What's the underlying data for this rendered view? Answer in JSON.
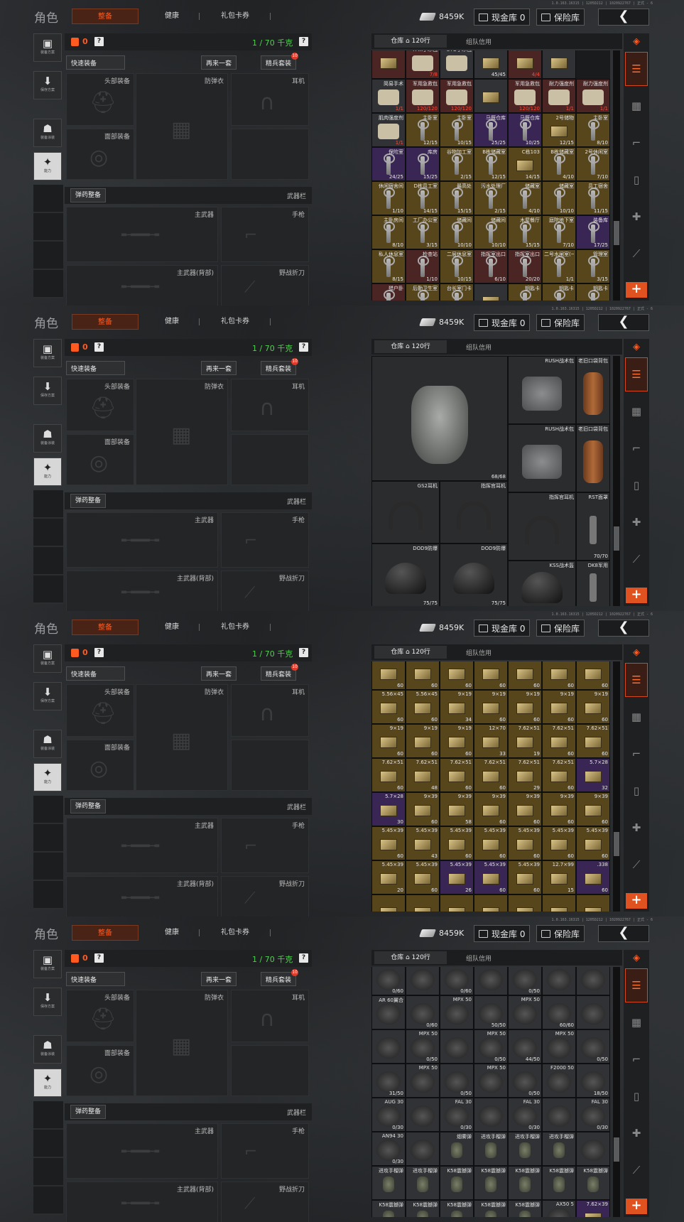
{
  "version": "1.0.163.16315 | 1205D212 | 1020922767 | 正式 - 6",
  "topbar": {
    "title": "角色",
    "tabs": [
      "整备",
      "健康",
      "礼包卡券"
    ],
    "coins": "8459K",
    "cash": "现金库 0",
    "safe": "保险库",
    "back": "❮"
  },
  "left": {
    "b1": "装备方案",
    "b2": "保存方案",
    "b3": "装备涂装",
    "b4": "能力"
  },
  "equip": {
    "count": "0",
    "help": "?",
    "weight": "1 / 70 千克",
    "quick": "快速装备",
    "again": "再来一套",
    "elite": "精兵套装",
    "elite_badge": "10",
    "head": "头部装备",
    "armor": "防弹衣",
    "ear": "耳机",
    "face": "面部装备",
    "ammo_btn": "弹药整备",
    "weapon_bar": "武器栏",
    "main": "主武器",
    "pistol": "手枪",
    "main_back": "主武器(背部)",
    "knife": "野战折刀"
  },
  "stash": {
    "tab1": "仓库 ⌂ 120行",
    "tab2": "组队信用",
    "plus": "+"
  },
  "accent": "#ff5a1f",
  "green": "#4fd14f",
  "gold_bg": "#57461c",
  "purple_bg": "#3a2654",
  "frames": [
    {
      "layout": "grid",
      "rows": [
        [
          {
            "n": "",
            "c": "",
            "t": "r"
          },
          {
            "n": "TMK手术包",
            "c": "7/8",
            "t": "r",
            "red": true,
            "span": 2
          },
          {
            "n": "STO手术包",
            "c": "",
            "t": "n"
          },
          {
            "n": "",
            "c": "45/45",
            "t": "n"
          },
          {
            "n": "",
            "c": "4/4",
            "t": "r",
            "red": true
          },
          {
            "n": "",
            "c": "",
            "t": "n"
          }
        ],
        [
          {
            "n": "简易手术",
            "c": "1/1",
            "t": "n",
            "red": true
          },
          {
            "n": "军用急救包",
            "c": "120/120",
            "t": "r",
            "red": true
          },
          {
            "n": "军用急救包",
            "c": "120/120",
            "t": "r",
            "red": true
          },
          {
            "n": "",
            "c": "",
            "t": "n"
          },
          {
            "n": "军用急救包",
            "c": "120/120",
            "t": "r",
            "red": true
          },
          {
            "n": "耐力强度剂",
            "c": "1/1",
            "t": "r",
            "red": true
          },
          {
            "n": "耐力强度剂",
            "c": "1/1",
            "t": "r",
            "red": true
          }
        ],
        [
          {
            "n": "肌肉强度剂",
            "c": "1/1",
            "t": "n",
            "red": true
          },
          {
            "n": "主卧室",
            "c": "12/15",
            "t": "g"
          },
          {
            "n": "主卧室",
            "c": "10/15",
            "t": "g"
          },
          {
            "n": "马厩仓库",
            "c": "25/25",
            "t": "p"
          },
          {
            "n": "马厩仓库",
            "c": "10/25",
            "t": "p"
          },
          {
            "n": "2号储物",
            "c": "12/15",
            "t": "g"
          },
          {
            "n": "主卧室",
            "c": "8/10",
            "t": "g"
          }
        ],
        [
          {
            "n": "保险室",
            "c": "24/25",
            "t": "p"
          },
          {
            "n": "库房",
            "c": "15/25",
            "t": "p"
          },
          {
            "n": "谷物加工室",
            "c": "2/15",
            "t": "g"
          },
          {
            "n": "B栋储藏室",
            "c": "12/15",
            "t": "g"
          },
          {
            "n": "C栋103",
            "c": "14/15",
            "t": "g"
          },
          {
            "n": "B栋储藏室",
            "c": "4/10",
            "t": "g"
          },
          {
            "n": "2号休闲室",
            "c": "7/10",
            "t": "g"
          }
        ],
        [
          {
            "n": "休闲宿舍间",
            "c": "1/10",
            "t": "g"
          },
          {
            "n": "D栋员工室",
            "c": "14/15",
            "t": "g"
          },
          {
            "n": "最高处",
            "c": "15/15",
            "t": "g"
          },
          {
            "n": "污水处理厂",
            "c": "2/15",
            "t": "g"
          },
          {
            "n": "储藏室",
            "c": "4/10",
            "t": "g"
          },
          {
            "n": "储藏室",
            "c": "10/10",
            "t": "g"
          },
          {
            "n": "员工宿舍",
            "c": "11/15",
            "t": "g"
          }
        ],
        [
          {
            "n": "主卧房间",
            "c": "8/10",
            "t": "g"
          },
          {
            "n": "工厂办公室",
            "c": "3/15",
            "t": "g"
          },
          {
            "n": "储藏间",
            "c": "10/10",
            "t": "g"
          },
          {
            "n": "储藏间",
            "c": "10/10",
            "t": "g"
          },
          {
            "n": "木屋餐厅",
            "c": "15/15",
            "t": "g"
          },
          {
            "n": "庭院地下室",
            "c": "7/10",
            "t": "g"
          },
          {
            "n": "装备库",
            "c": "17/25",
            "t": "p"
          }
        ],
        [
          {
            "n": "私人休息室",
            "c": "8/15",
            "t": "g"
          },
          {
            "n": "检查站",
            "c": "1/10",
            "t": "r"
          },
          {
            "n": "二层休息室",
            "c": "10/15",
            "t": "g"
          },
          {
            "n": "指挥室出口",
            "c": "6/10",
            "t": "r"
          },
          {
            "n": "指挥室出口",
            "c": "20/20",
            "t": "r"
          },
          {
            "n": "二号水闸室(一次性)",
            "c": "1/1",
            "t": "g"
          },
          {
            "n": "管理室",
            "c": "3/15",
            "t": "g"
          }
        ],
        [
          {
            "n": "猎户卧",
            "c": "",
            "t": "r"
          },
          {
            "n": "后勤卫生室",
            "c": "",
            "t": "g"
          },
          {
            "n": "台长室门卡",
            "c": "",
            "t": "g"
          },
          {
            "n": "",
            "c": "",
            "t": "n"
          },
          {
            "n": "钥匙卡",
            "c": "",
            "t": "g"
          },
          {
            "n": "钥匙卡",
            "c": "",
            "t": "g"
          },
          {
            "n": "钥匙卡",
            "c": "",
            "t": "g"
          }
        ]
      ]
    },
    {
      "layout": "big",
      "items": [
        {
          "n": "",
          "c": "68/68",
          "art": "vest"
        },
        {
          "n": "RUSH战术包",
          "c": "",
          "art": "pack"
        },
        {
          "n": "老旧口袋背包",
          "c": "",
          "art": "roll"
        },
        {
          "n": "RUSH战术包",
          "c": "",
          "art": "pack"
        },
        {
          "n": "老旧口袋背包",
          "c": "",
          "art": "roll"
        },
        {
          "n": "GS2耳机",
          "c": "",
          "art": "head"
        },
        {
          "n": "指挥官耳机",
          "c": "",
          "art": "head"
        },
        {
          "n": "指挥官耳机",
          "c": "",
          "art": "head"
        },
        {
          "n": "RST面罩",
          "c": "70/70",
          "art": "stick"
        },
        {
          "n": "DOD9防爆",
          "c": "75/75",
          "art": "helm"
        },
        {
          "n": "DOD9防爆",
          "c": "75/75",
          "art": "helm"
        },
        {
          "n": "KSS战术盔",
          "c": "",
          "art": "helm"
        },
        {
          "n": "DK8军用",
          "c": "",
          "art": "stick"
        }
      ]
    },
    {
      "layout": "grid",
      "rows": [
        [
          {
            "n": "5.56×45",
            "c": "60",
            "t": "g"
          },
          {
            "n": "5.56×45",
            "c": "60",
            "t": "g"
          },
          {
            "n": "5.56×45",
            "c": "60",
            "t": "g"
          },
          {
            "n": "5.56×45",
            "c": "60",
            "t": "g"
          },
          {
            "n": "5.56×45",
            "c": "60",
            "t": "g"
          },
          {
            "n": "5.56×45",
            "c": "60",
            "t": "g"
          },
          {
            "n": "5.56×45",
            "c": "60",
            "t": "g"
          }
        ],
        [
          {
            "n": "5.56×45",
            "c": "60",
            "t": "g"
          },
          {
            "n": "5.56×45",
            "c": "60",
            "t": "g"
          },
          {
            "n": "9×19",
            "c": "34",
            "t": "g"
          },
          {
            "n": "9×19",
            "c": "60",
            "t": "g"
          },
          {
            "n": "9×19",
            "c": "60",
            "t": "g"
          },
          {
            "n": "9×19",
            "c": "60",
            "t": "g"
          },
          {
            "n": "9×19",
            "c": "60",
            "t": "g"
          }
        ],
        [
          {
            "n": "9×19",
            "c": "60",
            "t": "g"
          },
          {
            "n": "9×19",
            "c": "60",
            "t": "g"
          },
          {
            "n": "9×19",
            "c": "60",
            "t": "g"
          },
          {
            "n": "12×70",
            "c": "33",
            "t": "g"
          },
          {
            "n": "7.62×51",
            "c": "19",
            "t": "g"
          },
          {
            "n": "7.62×51",
            "c": "60",
            "t": "g"
          },
          {
            "n": "7.62×51",
            "c": "60",
            "t": "g"
          }
        ],
        [
          {
            "n": "7.62×51",
            "c": "60",
            "t": "g"
          },
          {
            "n": "7.62×51",
            "c": "48",
            "t": "g"
          },
          {
            "n": "7.62×51",
            "c": "60",
            "t": "g"
          },
          {
            "n": "7.62×51",
            "c": "60",
            "t": "g"
          },
          {
            "n": "7.62×51",
            "c": "29",
            "t": "g"
          },
          {
            "n": "7.62×51",
            "c": "60",
            "t": "g"
          },
          {
            "n": "5.7×28",
            "c": "32",
            "t": "p"
          }
        ],
        [
          {
            "n": "5.7×28",
            "c": "30",
            "t": "p"
          },
          {
            "n": "9×39",
            "c": "60",
            "t": "g"
          },
          {
            "n": "9×39",
            "c": "58",
            "t": "g"
          },
          {
            "n": "9×39",
            "c": "60",
            "t": "g"
          },
          {
            "n": "9×39",
            "c": "60",
            "t": "g"
          },
          {
            "n": "9×39",
            "c": "60",
            "t": "g"
          },
          {
            "n": "9×39",
            "c": "60",
            "t": "g"
          }
        ],
        [
          {
            "n": "5.45×39",
            "c": "60",
            "t": "g"
          },
          {
            "n": "5.45×39",
            "c": "43",
            "t": "g"
          },
          {
            "n": "5.45×39",
            "c": "60",
            "t": "g"
          },
          {
            "n": "5.45×39",
            "c": "60",
            "t": "g"
          },
          {
            "n": "5.45×39",
            "c": "60",
            "t": "g"
          },
          {
            "n": "5.45×39",
            "c": "60",
            "t": "g"
          },
          {
            "n": "5.45×39",
            "c": "60",
            "t": "g"
          }
        ],
        [
          {
            "n": "5.45×39",
            "c": "20",
            "t": "g"
          },
          {
            "n": "5.45×39",
            "c": "60",
            "t": "g"
          },
          {
            "n": "5.45×39",
            "c": "26",
            "t": "p"
          },
          {
            "n": "5.45×39",
            "c": "60",
            "t": "p"
          },
          {
            "n": "5.45×39",
            "c": "60",
            "t": "g"
          },
          {
            "n": "12.7×99",
            "c": "15",
            "t": "g"
          },
          {
            "n": ".338",
            "c": "60",
            "t": "p"
          }
        ],
        [
          {
            "n": "",
            "c": "",
            "t": "g"
          },
          {
            "n": "",
            "c": "",
            "t": "g"
          },
          {
            "n": "",
            "c": "",
            "t": "g"
          },
          {
            "n": "",
            "c": "",
            "t": "g"
          },
          {
            "n": "",
            "c": "",
            "t": "g"
          },
          {
            "n": "",
            "c": "",
            "t": "g"
          },
          {
            "n": "",
            "c": "",
            "t": "g"
          }
        ]
      ]
    },
    {
      "layout": "grid",
      "rows": [
        [
          {
            "n": "",
            "c": "0/60",
            "t": "n"
          },
          {
            "n": "",
            "c": "",
            "t": "n"
          },
          {
            "n": "",
            "c": "0/60",
            "t": "n"
          },
          {
            "n": "",
            "c": "",
            "t": "n"
          },
          {
            "n": "",
            "c": "0/50",
            "t": "n"
          },
          {
            "n": "",
            "c": "",
            "t": "n"
          },
          {
            "n": "",
            "c": "",
            "t": "n"
          }
        ],
        [
          {
            "n": "AR 60翼合",
            "c": "",
            "t": "n"
          },
          {
            "n": "",
            "c": "0/60",
            "t": "n"
          },
          {
            "n": "MPX 50",
            "c": "",
            "t": "n"
          },
          {
            "n": "",
            "c": "50/50",
            "t": "n"
          },
          {
            "n": "MPX 50",
            "c": "",
            "t": "n"
          },
          {
            "n": "",
            "c": "60/60",
            "t": "n"
          },
          {
            "n": "",
            "c": "",
            "t": "n"
          }
        ],
        [
          {
            "n": "",
            "c": "",
            "t": "n"
          },
          {
            "n": "MPX 50",
            "c": "0/50",
            "t": "n"
          },
          {
            "n": "",
            "c": "",
            "t": "n"
          },
          {
            "n": "MPX 50",
            "c": "0/50",
            "t": "n"
          },
          {
            "n": "",
            "c": "44/50",
            "t": "n"
          },
          {
            "n": "MPX 50",
            "c": "",
            "t": "n"
          },
          {
            "n": "",
            "c": "0/50",
            "t": "n"
          }
        ],
        [
          {
            "n": "",
            "c": "31/50",
            "t": "n"
          },
          {
            "n": "MPX 50",
            "c": "",
            "t": "n"
          },
          {
            "n": "",
            "c": "0/50",
            "t": "n"
          },
          {
            "n": "MPX 50",
            "c": "",
            "t": "n"
          },
          {
            "n": "",
            "c": "0/50",
            "t": "n"
          },
          {
            "n": "F2000 50",
            "c": "",
            "t": "n"
          },
          {
            "n": "",
            "c": "18/50",
            "t": "n"
          }
        ],
        [
          {
            "n": "AUG 30",
            "c": "0/30",
            "t": "n"
          },
          {
            "n": "",
            "c": "",
            "t": "n"
          },
          {
            "n": "FAL 30",
            "c": "0/30",
            "t": "n"
          },
          {
            "n": "",
            "c": "",
            "t": "n"
          },
          {
            "n": "FAL 30",
            "c": "0/30",
            "t": "n"
          },
          {
            "n": "",
            "c": "",
            "t": "n"
          },
          {
            "n": "FAL 30",
            "c": "0/30",
            "t": "n"
          }
        ],
        [
          {
            "n": "AN94 30",
            "c": "0/30",
            "t": "n"
          },
          {
            "n": "",
            "c": "",
            "t": "n"
          },
          {
            "n": "烟雾弹",
            "c": "",
            "t": "n"
          },
          {
            "n": "进攻手榴弹",
            "c": "",
            "t": "n"
          },
          {
            "n": "进攻手榴弹",
            "c": "",
            "t": "n"
          },
          {
            "n": "进攻手榴弹",
            "c": "",
            "t": "n"
          },
          {
            "n": "",
            "c": "",
            "t": "n"
          }
        ],
        [
          {
            "n": "进攻手榴弹",
            "c": "",
            "t": "n"
          },
          {
            "n": "进攻手榴弹",
            "c": "",
            "t": "n"
          },
          {
            "n": "K58震撼弹",
            "c": "",
            "t": "n"
          },
          {
            "n": "K58震撼弹",
            "c": "",
            "t": "n"
          },
          {
            "n": "K58震撼弹",
            "c": "",
            "t": "n"
          },
          {
            "n": "K58震撼弹",
            "c": "",
            "t": "n"
          },
          {
            "n": "K58震撼弹",
            "c": "",
            "t": "n"
          }
        ],
        [
          {
            "n": "K58震撼弹",
            "c": "",
            "t": "n"
          },
          {
            "n": "K58震撼弹",
            "c": "",
            "t": "n"
          },
          {
            "n": "K58震撼弹",
            "c": "",
            "t": "n"
          },
          {
            "n": "K58震撼弹",
            "c": "",
            "t": "n"
          },
          {
            "n": "K58震撼弹",
            "c": "",
            "t": "n"
          },
          {
            "n": "AX50 5",
            "c": "4/5",
            "t": "n"
          },
          {
            "n": "7.62×39",
            "c": "11",
            "t": "p"
          }
        ]
      ]
    }
  ]
}
